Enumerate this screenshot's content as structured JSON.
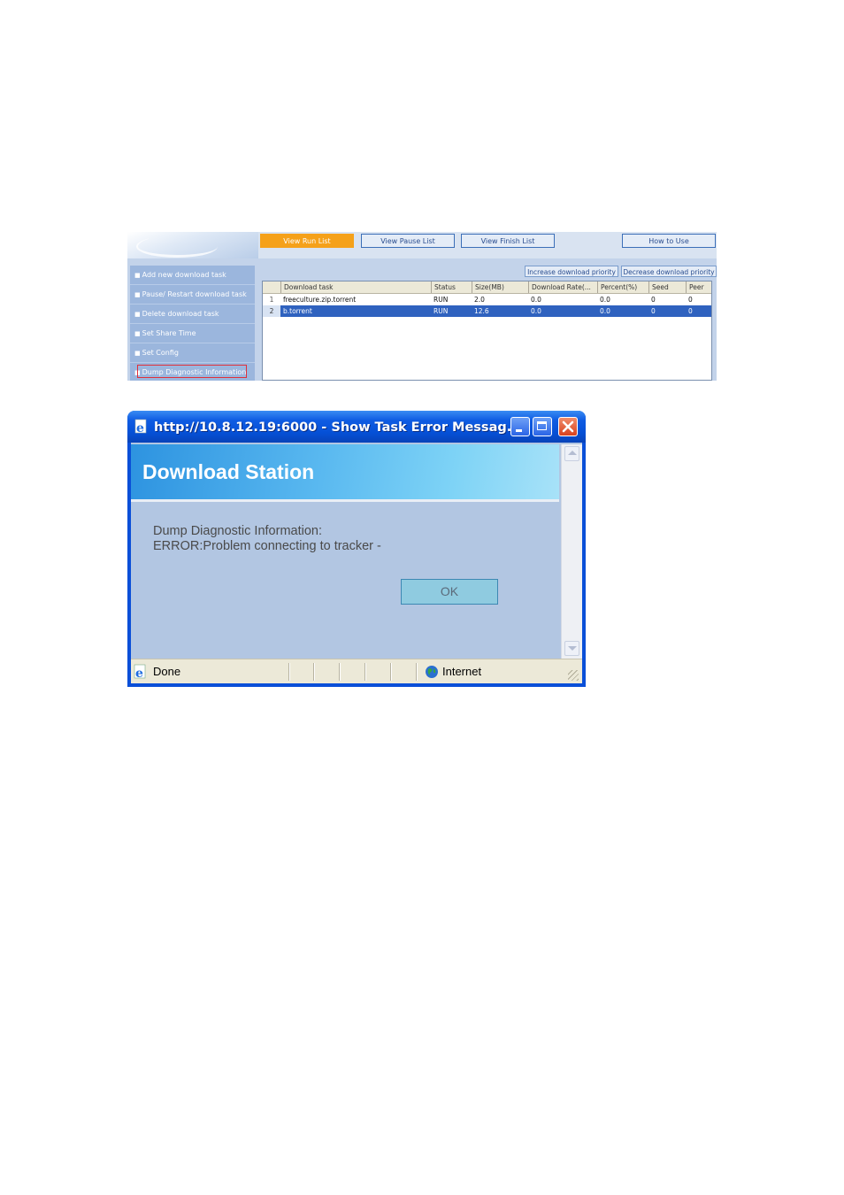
{
  "download_station": {
    "tabs": [
      {
        "label": "View Run List",
        "active": true
      },
      {
        "label": "View Pause List",
        "active": false
      },
      {
        "label": "View Finish List",
        "active": false
      },
      {
        "label": "How to Use",
        "active": false
      }
    ],
    "sidebar": {
      "items": [
        {
          "label": "Add new download task"
        },
        {
          "label": "Pause/ Restart download task"
        },
        {
          "label": "Delete download task"
        },
        {
          "label": "Set Share Time"
        },
        {
          "label": "Set Config"
        },
        {
          "label": "Dump Diagnostic Information",
          "highlighted": true
        }
      ]
    },
    "priority": {
      "increase_label": "Increase download priority",
      "decrease_label": "Decrease download priority"
    },
    "table": {
      "columns": [
        "",
        "Download task",
        "Status",
        "Size(MB)",
        "Download Rate(...",
        "Percent(%)",
        "Seed",
        "Peer"
      ],
      "rows": [
        {
          "num": "1",
          "task": "freeculture.zip.torrent",
          "status": "RUN",
          "size": "2.0",
          "rate": "0.0",
          "percent": "0.0",
          "seed": "0",
          "peer": "0",
          "selected": false
        },
        {
          "num": "2",
          "task": "b.torrent",
          "status": "RUN",
          "size": "12.6",
          "rate": "0.0",
          "percent": "0.0",
          "seed": "0",
          "peer": "0",
          "selected": true
        }
      ]
    },
    "colors": {
      "active_tab": "#f5a11a",
      "selected_row": "#2f62bf",
      "highlight_border": "#e0303a"
    }
  },
  "popup": {
    "title": "http://10.8.12.19:6000 - Show Task Error Messag...",
    "banner_title": "Download Station",
    "message_lines": [
      "Dump Diagnostic Information:",
      "ERROR:Problem connecting to tracker -"
    ],
    "ok_label": "OK",
    "status": {
      "text": "Done",
      "zone": "Internet"
    },
    "icons": [
      "ie-page-icon",
      "minimize-icon",
      "maximize-icon",
      "close-icon",
      "globe-icon",
      "resize-grip-icon"
    ]
  }
}
